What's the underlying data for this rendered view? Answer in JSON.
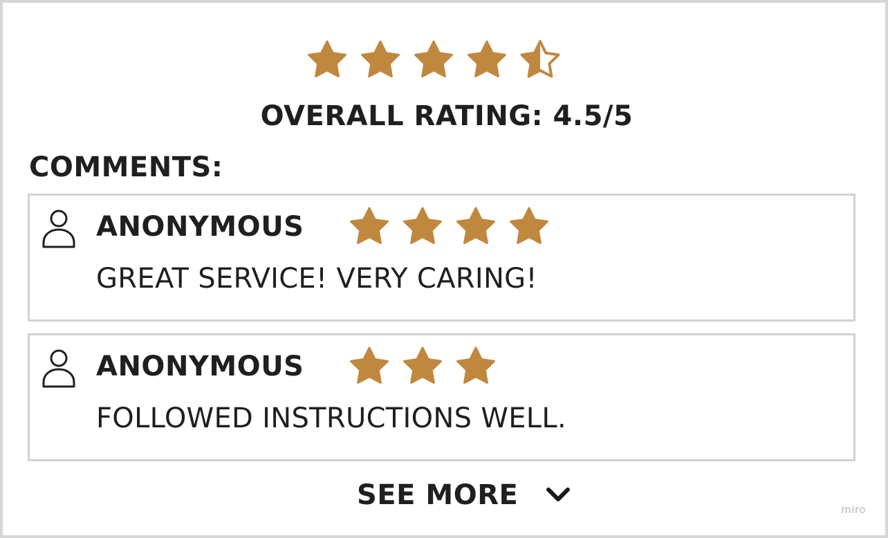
{
  "colors": {
    "star": "#c0883f",
    "text": "#1f1f1f",
    "border": "#d3d3d3",
    "watermark": "#b8b8b8"
  },
  "overall": {
    "rating_value": 4.5,
    "max_rating": 5,
    "label": "OVERALL RATING: 4.5/5"
  },
  "comments": {
    "heading": "COMMENTS:",
    "items": [
      {
        "author": "ANONYMOUS",
        "rating_value": 4,
        "text": "GREAT SERVICE! VERY CARING!",
        "icon": "user-icon"
      },
      {
        "author": "ANONYMOUS",
        "rating_value": 3,
        "text": "FOLLOWED INSTRUCTIONS WELL.",
        "icon": "user-icon"
      }
    ]
  },
  "see_more": {
    "label": "SEE MORE",
    "icon": "chevron-down-icon"
  },
  "watermark": "miro"
}
